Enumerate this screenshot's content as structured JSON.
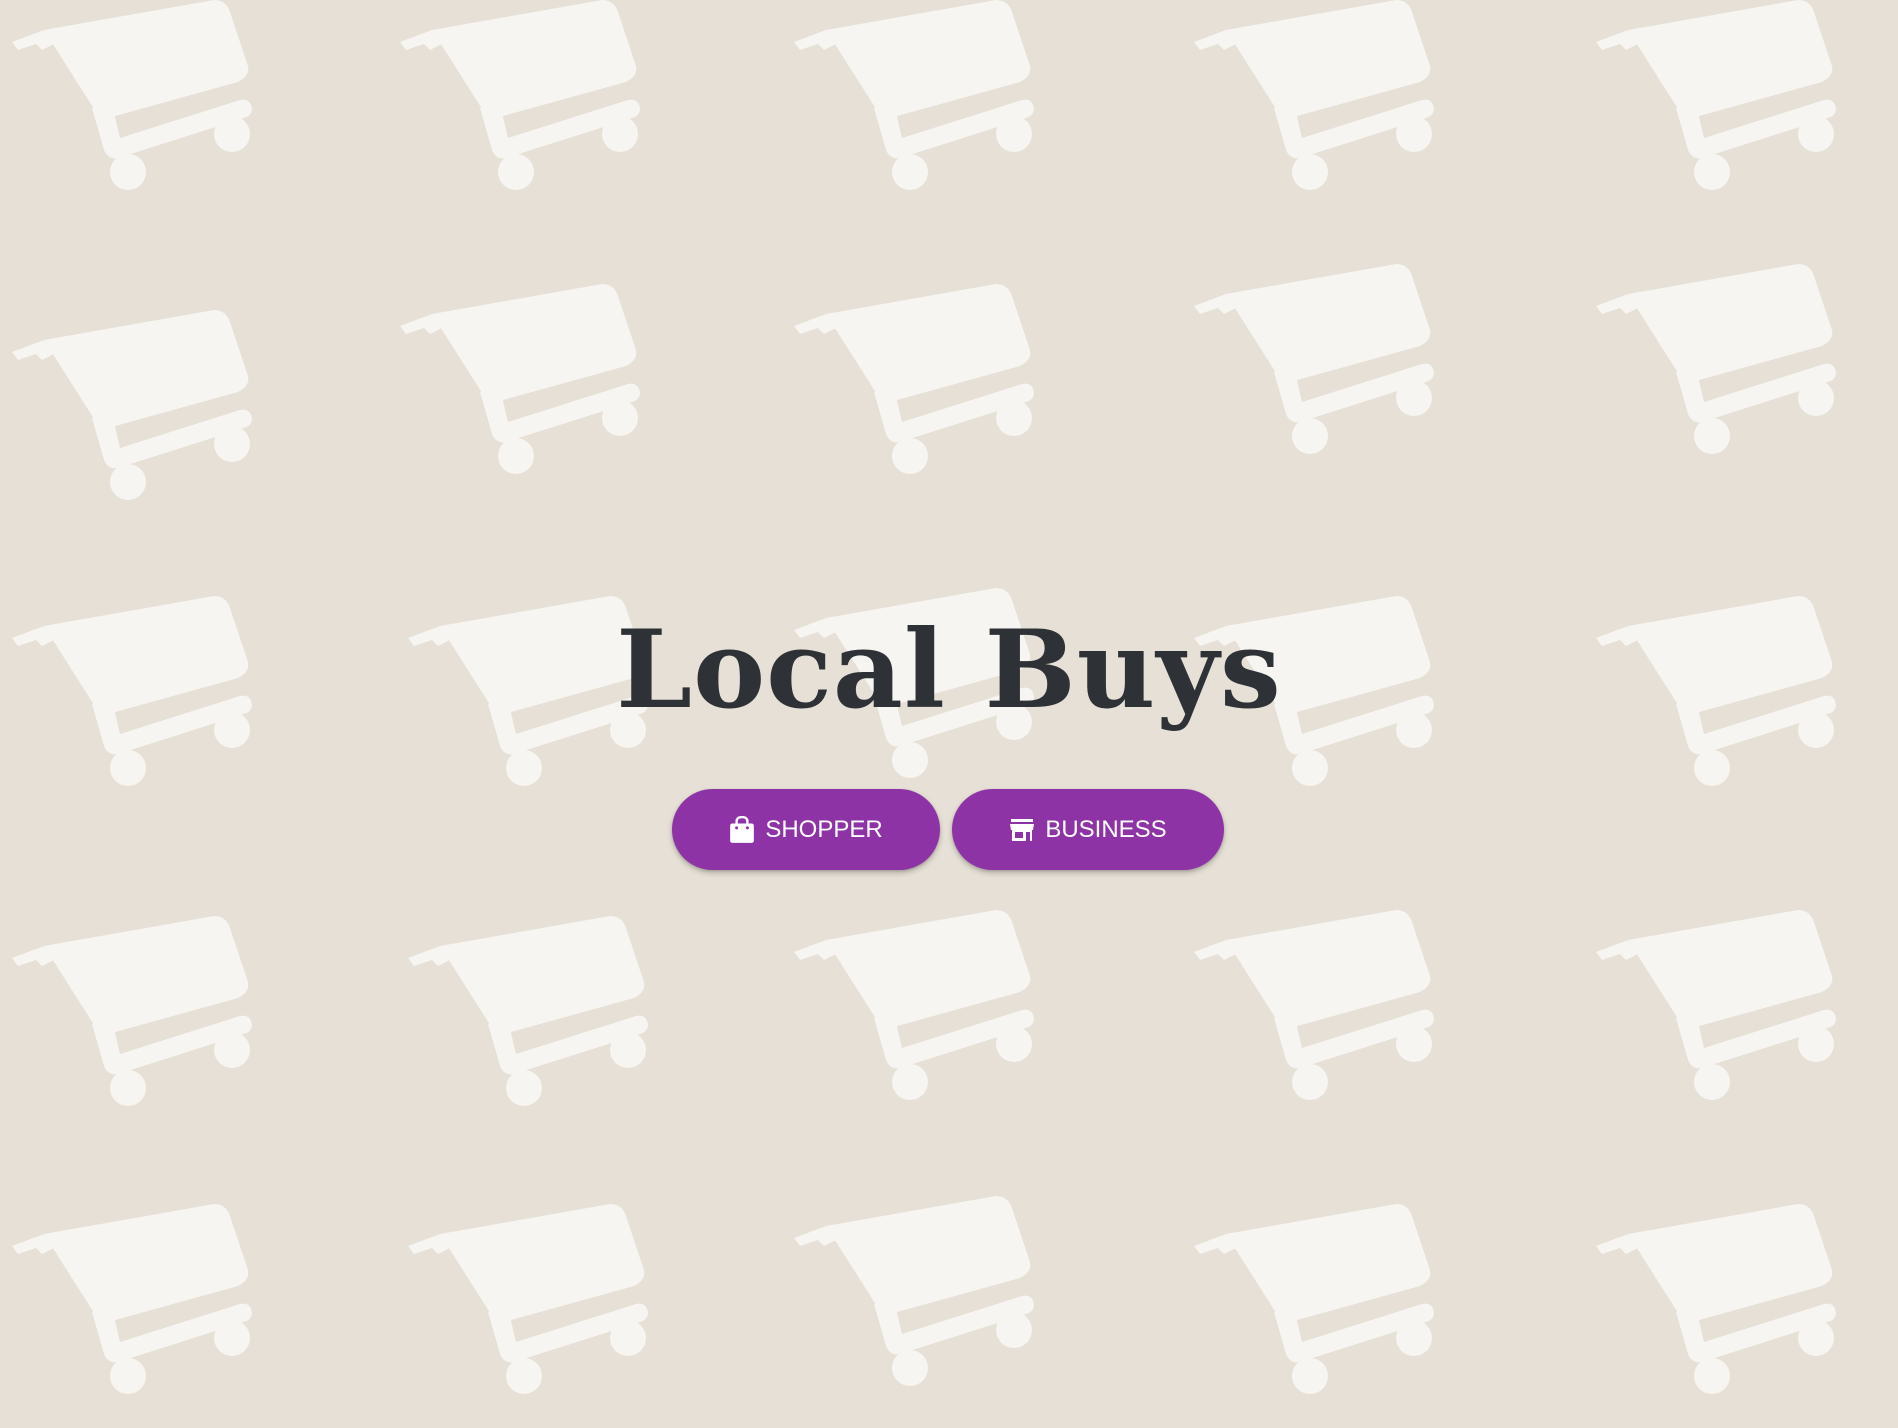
{
  "app": {
    "title": "Local Buys"
  },
  "actions": {
    "shopper": {
      "label": "SHOPPER",
      "icon": "shopping-bag-icon"
    },
    "business": {
      "label": "BUSINESS",
      "icon": "storefront-icon"
    }
  },
  "background": {
    "pattern_icon": "shopping-cart-icon"
  },
  "colors": {
    "background": "#e6e0d6",
    "pattern": "#f7f5f1",
    "title": "#2e3236",
    "button": "#8e33a6",
    "button_text": "#ffffff"
  }
}
